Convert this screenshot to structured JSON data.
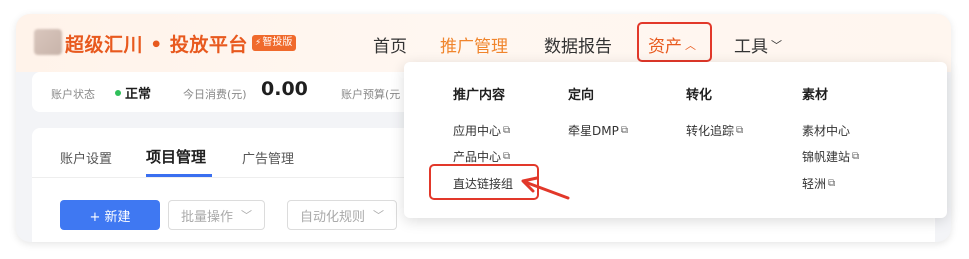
{
  "header": {
    "brand_title": "超级汇川 • 投放平台",
    "brand_badge": "智投版",
    "nav": [
      {
        "label": "首页"
      },
      {
        "label": "推广管理"
      },
      {
        "label": "数据报告"
      },
      {
        "label": "资产"
      },
      {
        "label": "工具"
      }
    ]
  },
  "status": {
    "account_status_label": "账户状态",
    "account_status_value": "正常",
    "today_spend_label": "今日消费(元)",
    "today_spend_value": "0.00",
    "budget_label": "账户预算(元"
  },
  "tabs": [
    "账户设置",
    "项目管理",
    "广告管理"
  ],
  "toolbar": {
    "new_label": "+ 新建",
    "batch_label": "批量操作",
    "automation_label": "自动化规则"
  },
  "asset_menu": {
    "columns": [
      {
        "title": "推广内容",
        "items": [
          "应用中心",
          "产品中心",
          "直达链接组"
        ]
      },
      {
        "title": "定向",
        "items": [
          "牵星DMP"
        ]
      },
      {
        "title": "转化",
        "items": [
          "转化追踪"
        ]
      },
      {
        "title": "素材",
        "items": [
          "素材中心",
          "锦帆建站",
          "轻洲"
        ]
      }
    ]
  },
  "colors": {
    "brand_orange": "#e8591e",
    "active_nav": "#f0852d",
    "primary_blue": "#3f78f2",
    "highlight_red": "#e2382a",
    "status_green": "#2fbf5a"
  }
}
